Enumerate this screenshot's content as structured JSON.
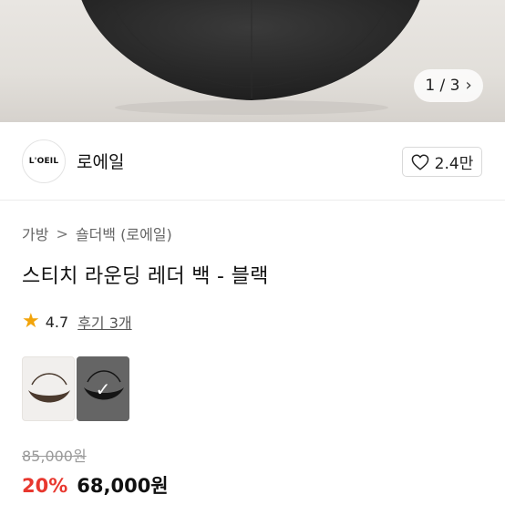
{
  "gallery": {
    "pager_text": "1 / 3",
    "pager_icon": "chevron-right-icon"
  },
  "brand": {
    "logo_text": "L'OEIL",
    "name": "로에일",
    "like_count": "2.4만",
    "like_icon": "heart-outline-icon"
  },
  "breadcrumb": {
    "items": [
      "가방",
      "숄더백 (로에일)"
    ],
    "separator": ">"
  },
  "product": {
    "title": "스티치 라운딩 레더 백 - 블랙",
    "rating": "4.7",
    "reviews_label": "후기 3개",
    "options": [
      {
        "name": "brown",
        "selected": false
      },
      {
        "name": "black",
        "selected": true
      }
    ],
    "original_price": "85,000원",
    "discount": "20%",
    "sale_price": "68,000원"
  },
  "colors": {
    "discount_red": "#e8382f",
    "star": "#f2a40a"
  }
}
